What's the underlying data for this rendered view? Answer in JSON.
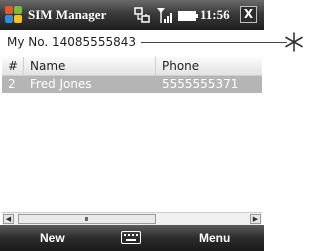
{
  "titlebar": {
    "title": "SIM Manager",
    "time": "11:56",
    "close_label": "X",
    "icons": [
      "windows-start-icon",
      "connectivity-icon",
      "signal-icon",
      "battery-icon"
    ]
  },
  "my_number": "My No. 14085555843",
  "callout_marker": "asterisk",
  "list": {
    "columns": [
      "#",
      "Name",
      "Phone"
    ],
    "rows": [
      {
        "index": "2",
        "name": "Fred Jones",
        "phone": "5555555371"
      }
    ]
  },
  "scrollbar": {
    "grip_label": "III"
  },
  "softkeys": {
    "left": "New",
    "right": "Menu",
    "center_icon": "keyboard-icon"
  },
  "colors": {
    "titlebar": "#2f2f2f",
    "selected_row": "#b5b5b5",
    "softbar": "#2c2c2c"
  }
}
